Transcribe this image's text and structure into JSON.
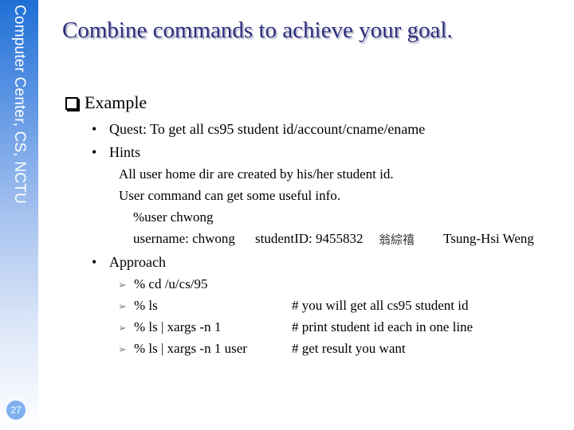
{
  "sidebar": {
    "title": "Computer Center, CS, NCTU",
    "page_number": "27",
    "gradient_top": "#1f6fd6",
    "gradient_bottom": "#ffffff"
  },
  "slide": {
    "title": "Combine commands to achieve your goal.",
    "title_color": "#2b2d7c",
    "section": {
      "label": "Example",
      "bullets": [
        {
          "label": "Quest: To get all cs95 student id/account/cname/ename"
        },
        {
          "label": "Hints"
        },
        {
          "label": "Approach"
        }
      ]
    },
    "hints": {
      "line1": "All user home dir are created by his/her student id.",
      "line2": "User command can get some useful info.",
      "command": "%user chwong",
      "output": {
        "username": "username: chwong",
        "student_id": "studentID: 9455832",
        "cname": "翁綜禧",
        "ename": "Tsung-Hsi Weng"
      }
    },
    "approach": [
      {
        "command": "% cd /u/cs/95",
        "comment": ""
      },
      {
        "command": "% ls",
        "comment": "# you will get all cs95 student id"
      },
      {
        "command": "% ls | xargs -n 1",
        "comment": "# print student id each in one line"
      },
      {
        "command": "% ls | xargs -n 1 user",
        "comment": "# get result you want"
      }
    ]
  }
}
